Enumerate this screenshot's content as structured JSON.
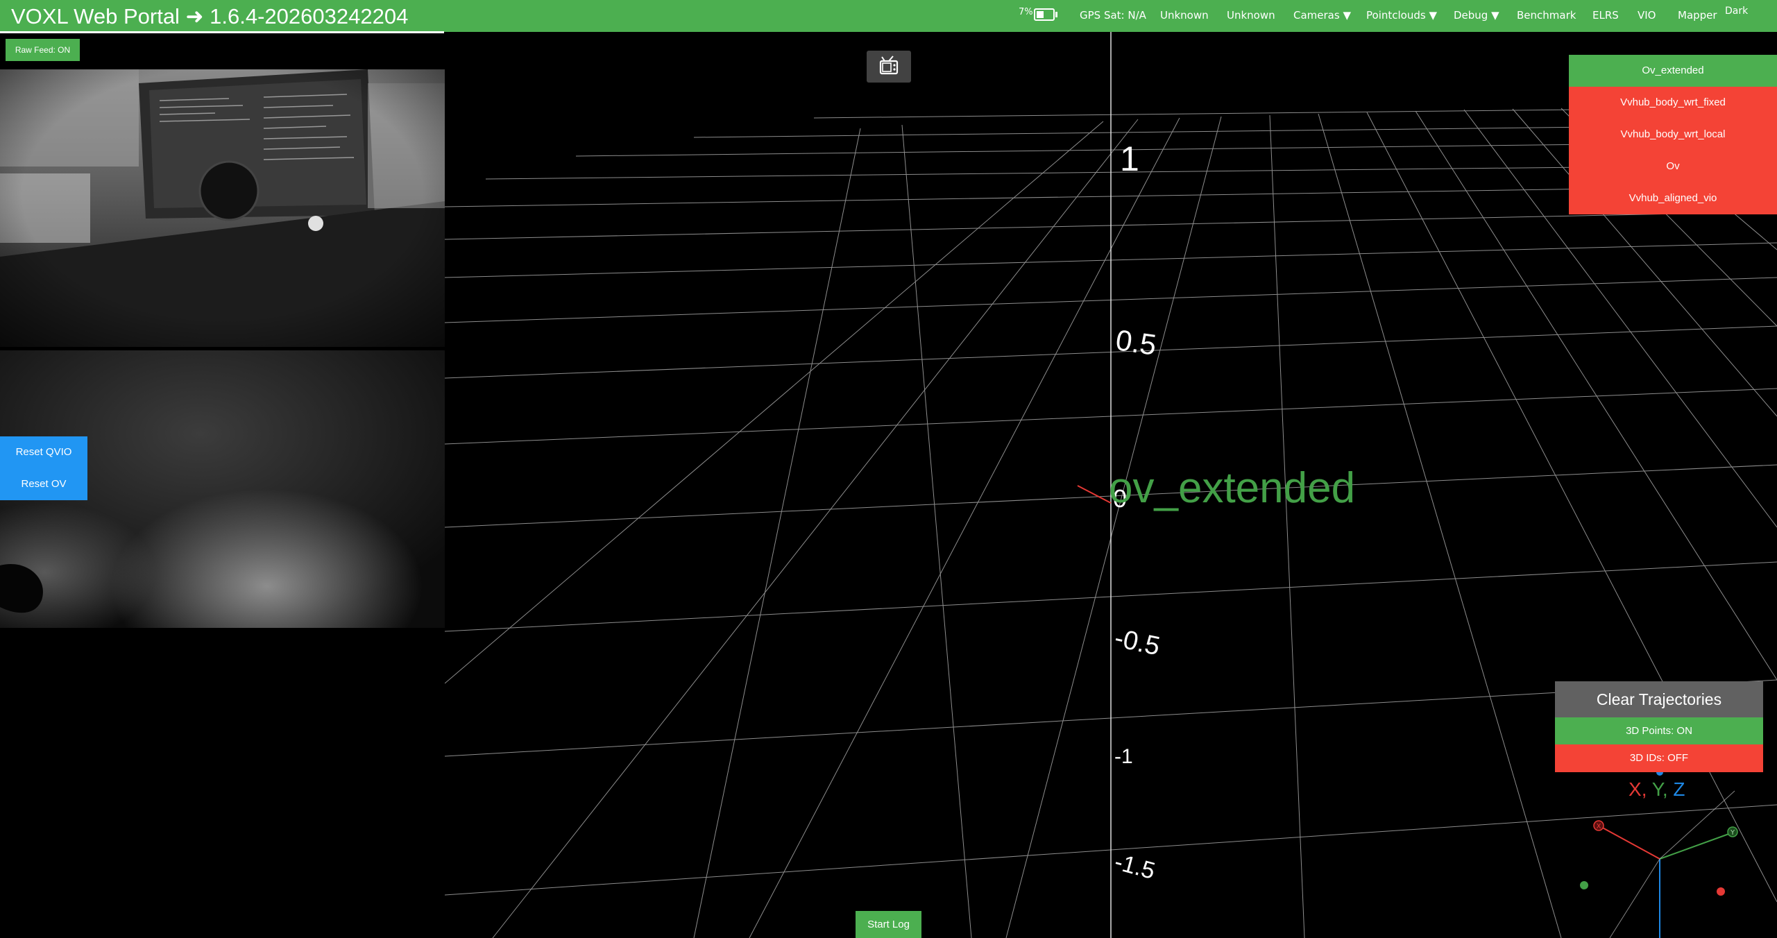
{
  "header": {
    "title": "VOXL Web Portal ➜ 1.6.4-202603242204",
    "battery_text": "7%",
    "gps": "GPS Sat: N/A",
    "status1": "Unknown",
    "status2": "Unknown",
    "cameras": "Cameras ▼",
    "pointclouds": "Pointclouds ▼",
    "debug": "Debug ▼",
    "benchmark": "Benchmark",
    "elrs": "ELRS",
    "vio": "VIO",
    "mapper": "Mapper",
    "dark": "Dark"
  },
  "left_panel": {
    "raw_feed": "Raw Feed: ON",
    "reset_qvio": "Reset QVIO",
    "reset_ov": "Reset OV"
  },
  "view3d": {
    "center_label": "ov_extended",
    "z_ticks": [
      "1",
      "0.5",
      "0",
      "-0.5",
      "-1",
      "-1.5"
    ],
    "mini_axes_labels": [
      "X",
      "Y",
      "Z"
    ],
    "mini_axes_letters": [
      "X",
      "Y"
    ]
  },
  "trajectories": {
    "items": [
      {
        "label": "Ov_extended",
        "active": true
      },
      {
        "label": "Vvhub_body_wrt_fixed",
        "active": false
      },
      {
        "label": "Vvhub_body_wrt_local",
        "active": false
      },
      {
        "label": "Ov",
        "active": false
      },
      {
        "label": "Vvhub_aligned_vio",
        "active": false
      }
    ]
  },
  "controls": {
    "clear_trajectories": "Clear Trajectories",
    "points_3d": "3D Points: ON",
    "ids_3d": "3D IDs: OFF",
    "start_log": "Start Log"
  },
  "colors": {
    "accent_green": "#4caf50",
    "off_red": "#f44336",
    "reset_blue": "#2196f3",
    "axis_x": "#e53935",
    "axis_y": "#43a047",
    "axis_z": "#1e88e5"
  }
}
